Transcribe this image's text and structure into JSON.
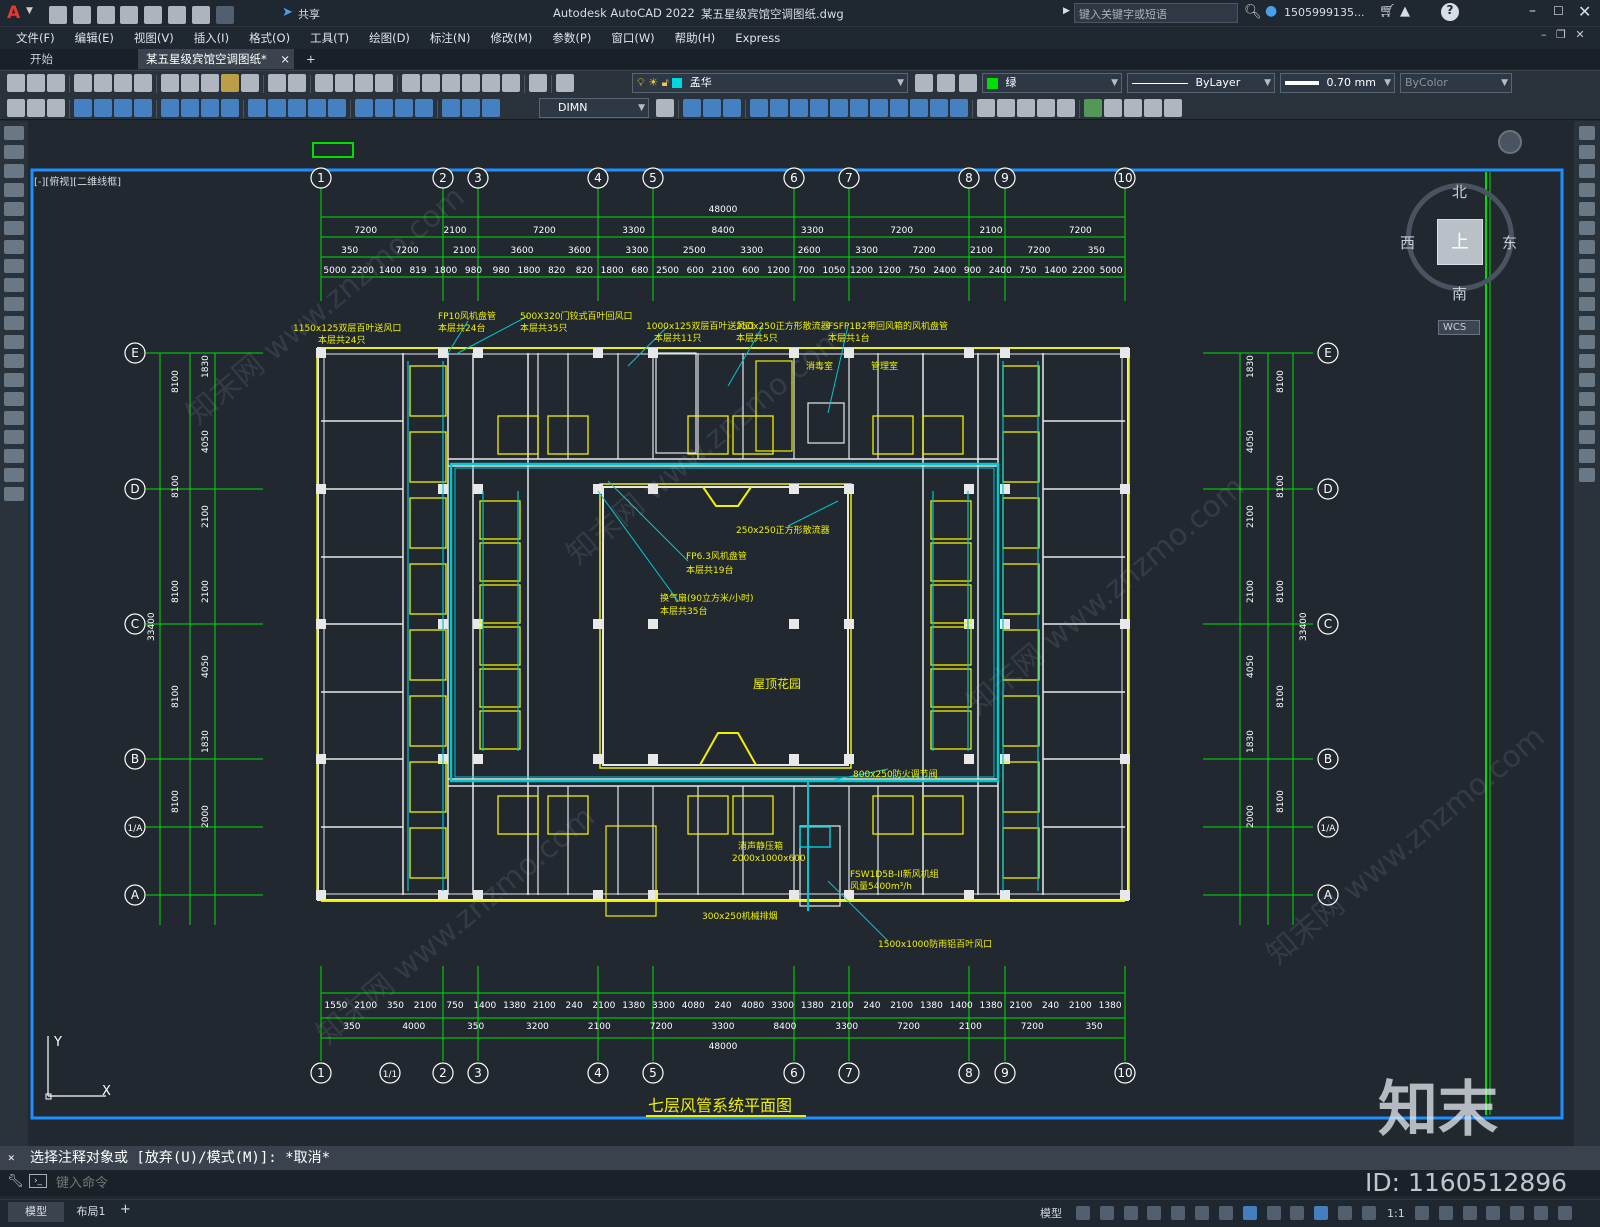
{
  "app": {
    "title": "Autodesk AutoCAD 2022",
    "document": "某五星级宾馆空调图纸.dwg",
    "search_placeholder": "键入关键字或短语",
    "user": "1505999135...",
    "share_label": "共享",
    "logo_letter": "A"
  },
  "menu": [
    "文件(F)",
    "编辑(E)",
    "视图(V)",
    "插入(I)",
    "格式(O)",
    "工具(T)",
    "绘图(D)",
    "标注(N)",
    "修改(M)",
    "参数(P)",
    "窗口(W)",
    "帮助(H)",
    "Express"
  ],
  "tabs": {
    "start": "开始",
    "active": "某五星级宾馆空调图纸*",
    "close": "×",
    "add": "+"
  },
  "toolbar": {
    "layer_name": "孟华",
    "color": "绿",
    "linetype": "ByLayer",
    "lineweight": "0.70 mm",
    "plotstyle": "ByColor",
    "dimstyle": "DIMN"
  },
  "viewport": {
    "label": "[-][俯视][二维线框]",
    "compass": {
      "north": "北",
      "south": "南",
      "east": "东",
      "west": "西",
      "top": "上"
    },
    "wcs": "WCS",
    "ucs_x": "X",
    "ucs_y": "Y"
  },
  "drawing": {
    "title": "七层风管系统平面图",
    "axis_top": [
      "1",
      "2",
      "3",
      "4",
      "5",
      "6",
      "7",
      "8",
      "9",
      "10"
    ],
    "axis_bottom": [
      "1",
      "1/1",
      "2",
      "3",
      "4",
      "5",
      "6",
      "7",
      "8",
      "9",
      "10"
    ],
    "axis_side": [
      "E",
      "D",
      "C",
      "B",
      "1/A",
      "A"
    ],
    "total_width": "48000",
    "dim_row1": [
      "7200",
      "2100",
      "7200",
      "3300",
      "8400",
      "3300",
      "7200",
      "2100",
      "7200"
    ],
    "dim_row2": [
      "350",
      "7200",
      "2100",
      "3600",
      "3600",
      "3300",
      "2500",
      "3300",
      "2600",
      "3300",
      "7200",
      "2100",
      "7200",
      "350"
    ],
    "dim_row3": [
      "5000",
      "2200",
      "1400",
      "819",
      "1800",
      "980",
      "980",
      "1800",
      "820",
      "820",
      "1800",
      "680",
      "2500",
      "600",
      "2100",
      "600",
      "1200",
      "700",
      "1050",
      "1200",
      "1200",
      "750",
      "2400",
      "900",
      "2400",
      "750",
      "1400",
      "2200",
      "5000"
    ],
    "dim_bottom1": [
      "1550",
      "2100",
      "350",
      "2100",
      "750",
      "1400",
      "1380",
      "2100",
      "240",
      "2100",
      "1380",
      "3300",
      "4080",
      "240",
      "4080",
      "3300",
      "1380",
      "2100",
      "240",
      "2100",
      "1380",
      "1400",
      "1380",
      "2100",
      "240",
      "2100",
      "1380"
    ],
    "dim_bottom2": [
      "350",
      "4000",
      "350",
      "3200",
      "2100",
      "7200",
      "3300",
      "8400",
      "3300",
      "7200",
      "2100",
      "7200",
      "350"
    ],
    "side_total": "33400",
    "side_main": [
      "8100",
      "8100",
      "8100",
      "8100",
      "8100"
    ],
    "side_detail": [
      "1830",
      "4050",
      "2100",
      "2100",
      "4050",
      "1830",
      "2000"
    ],
    "labels": {
      "l1": "1150x125双层百叶送风口",
      "l1b": "本层共24只",
      "l2": "FP10风机盘管",
      "l2b": "本层共24台",
      "l3": "500X320门铰式百叶回风口",
      "l3b": "本层共35只",
      "l4": "1000x125双层百叶送风口",
      "l4b": "本层共11只",
      "l5": "250x250正方形散流器",
      "l5b": "本层共5只",
      "l6": "FSFP1B2带回风箱的风机盘管",
      "l6b": "本层共1台",
      "l7": "250x250正方形散流器",
      "l8": "FP6.3风机盘管",
      "l8b": "本层共19台",
      "l9": "换气扇(90立方米/小时)",
      "l9b": "本层共35台",
      "l10": "屋顶花园",
      "l11": "800x250防火调节阀",
      "l12": "FSW1D5B-II新风机组",
      "l12b": "风量5400m³/h",
      "l13": "300x250机械排烟",
      "l14": "1500x1000防雨铝百叶风口",
      "l15": "消声静压箱",
      "l15b": "2000x1000x600",
      "r1": "消毒室",
      "r2": "管理室"
    }
  },
  "command": {
    "history": "选择注释对象或 [放弃(U)/模式(M)]: *取消*",
    "placeholder": "键入命令"
  },
  "status": {
    "model_tab": "模型",
    "layout_tab": "布局1",
    "add": "+",
    "model_label": "模型",
    "scale": "1:1",
    "watermark_id": "ID: 1160512896",
    "watermark_brand": "知末"
  },
  "colors": {
    "wall": "#e8e8e8",
    "yellow": "#f0f000",
    "green": "#00e000",
    "cyan": "#00c8d0",
    "accent": "#1e8fff"
  }
}
